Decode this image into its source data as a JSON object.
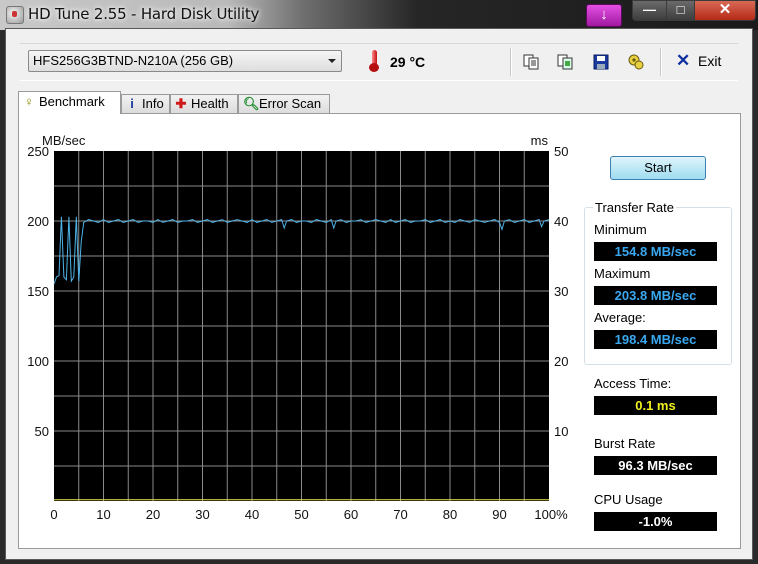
{
  "window": {
    "title": "HD Tune 2.55 - Hard Disk Utility",
    "controls": {
      "tray": "↓",
      "minimize": "—",
      "maximize": "□",
      "close": "✕"
    }
  },
  "toolbar": {
    "drive": "HFS256G3BTND-N210A (256 GB)",
    "temperature": "29 °C",
    "icons": [
      "copy-text-icon",
      "copy-screenshot-icon",
      "save-icon",
      "options-icon"
    ],
    "exit_label": "Exit"
  },
  "tabs": [
    {
      "label": "Benchmark",
      "icon": "lightbulb-icon",
      "active": true
    },
    {
      "label": "Info",
      "icon": "info-icon",
      "active": false
    },
    {
      "label": "Health",
      "icon": "health-cross-icon",
      "active": false
    },
    {
      "label": "Error Scan",
      "icon": "magnifier-icon",
      "active": false
    }
  ],
  "benchmark": {
    "start_label": "Start",
    "transfer_rate_title": "Transfer Rate",
    "minimum_label": "Minimum",
    "minimum_value": "154.8 MB/sec",
    "maximum_label": "Maximum",
    "maximum_value": "203.8 MB/sec",
    "average_label": "Average:",
    "average_value": "198.4 MB/sec",
    "access_time_label": "Access Time:",
    "access_time_value": "0.1 ms",
    "burst_rate_label": "Burst Rate",
    "burst_rate_value": "96.3 MB/sec",
    "cpu_usage_label": "CPU Usage",
    "cpu_usage_value": "-1.0%"
  },
  "colors": {
    "transfer_line": "#4fb3e8",
    "access_line": "#e8e84a",
    "grid": "#8a8a8a",
    "plot_bg": "#000000"
  },
  "chart_data": {
    "type": "line",
    "title": "",
    "xlabel": "%",
    "ylabel_left": "MB/sec",
    "ylabel_right": "ms",
    "xlim": [
      0,
      100
    ],
    "ylim_left": [
      0,
      250
    ],
    "ylim_right": [
      0,
      50
    ],
    "x_ticks": [
      "0",
      "10",
      "20",
      "30",
      "40",
      "50",
      "60",
      "70",
      "80",
      "90",
      "100%"
    ],
    "y_ticks_left": [
      "50",
      "100",
      "150",
      "200",
      "250"
    ],
    "y_ticks_right": [
      "10",
      "20",
      "30",
      "40",
      "50"
    ],
    "grid": true,
    "series": [
      {
        "name": "Transfer Rate (MB/sec)",
        "axis": "left",
        "x": [
          0,
          0.5,
          1,
          1.5,
          2,
          2.5,
          3,
          3.5,
          4,
          4.5,
          5,
          5.5,
          6,
          7,
          8,
          9,
          10,
          11,
          12,
          13,
          14,
          15,
          16,
          17,
          18,
          19,
          20,
          21,
          22,
          23,
          24,
          25,
          26,
          27,
          28,
          29,
          30,
          31,
          32,
          33,
          34,
          35,
          36,
          37,
          38,
          39,
          40,
          41,
          42,
          43,
          44,
          45,
          46,
          46.5,
          47,
          48,
          49,
          50,
          51,
          52,
          53,
          54,
          55,
          56,
          56.5,
          57,
          58,
          59,
          60,
          61,
          62,
          63,
          64,
          65,
          66,
          67,
          68,
          69,
          70,
          71,
          72,
          73,
          74,
          75,
          76,
          77,
          78,
          79,
          80,
          81,
          82,
          83,
          84,
          85,
          86,
          87,
          88,
          89,
          90,
          90.5,
          91,
          92,
          93,
          94,
          95,
          96,
          97,
          98,
          98.5,
          99,
          100
        ],
        "values": [
          155,
          160,
          161,
          203,
          160,
          158,
          203,
          157,
          160,
          203,
          157,
          185,
          199,
          201,
          200,
          199,
          201,
          199,
          200,
          201,
          199,
          200,
          201,
          199,
          200,
          200,
          199,
          201,
          199,
          200,
          201,
          199,
          200,
          200,
          201,
          199,
          200,
          201,
          199,
          200,
          201,
          199,
          200,
          201,
          200,
          199,
          201,
          199,
          200,
          201,
          199,
          200,
          201,
          195,
          200,
          201,
          199,
          200,
          200,
          199,
          201,
          200,
          199,
          201,
          195,
          200,
          201,
          199,
          200,
          200,
          201,
          199,
          200,
          201,
          200,
          199,
          201,
          199,
          200,
          201,
          199,
          200,
          200,
          201,
          199,
          200,
          201,
          199,
          200,
          199,
          201,
          200,
          199,
          201,
          200,
          199,
          200,
          201,
          199,
          194,
          200,
          201,
          199,
          200,
          201,
          199,
          200,
          201,
          196,
          200,
          201
        ]
      },
      {
        "name": "Access Time (ms)",
        "axis": "right",
        "x": [
          0,
          100
        ],
        "values": [
          0.1,
          0.1
        ]
      }
    ]
  }
}
